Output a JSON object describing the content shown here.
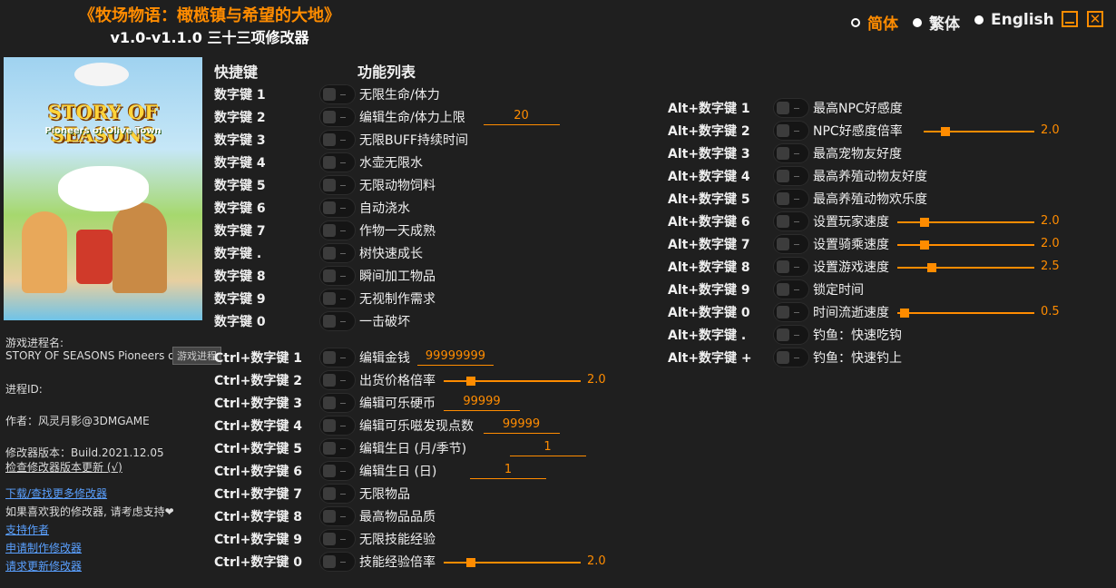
{
  "header": {
    "title": "《牧场物语：橄榄镇与希望的大地》",
    "subtitle": "v1.0-v1.1.0 三十三项修改器",
    "languages": [
      "简体",
      "繁体",
      "English"
    ],
    "selected_language": "简体",
    "accent_color": "#ff8c00"
  },
  "cover": {
    "logo": "STORY OF SEASONS",
    "sublogo": "Pioneers of Olive Town"
  },
  "info": {
    "process_label": "游戏进程名:",
    "process_value": "STORY OF SEASONS Pioneers of Olive",
    "process_tooltip": "游戏进程",
    "pid_label": "进程ID:",
    "author": "作者：风灵月影@3DMGAME",
    "version": "修改器版本：Build.2021.12.05",
    "check_update": "检查修改器版本更新 (√)",
    "download": "下载/查找更多修改器",
    "support_text": "如果喜欢我的修改器, 请考虑支持❤",
    "support_author": "支持作者",
    "request_make": "申请制作修改器",
    "request_update": "请求更新修改器"
  },
  "columns": {
    "hotkey": "快捷键",
    "features": "功能列表"
  },
  "left_features": [
    {
      "key": "数字键 1",
      "name": "无限生命/体力"
    },
    {
      "key": "数字键 2",
      "name": "编辑生命/体力上限",
      "value": "20"
    },
    {
      "key": "数字键 3",
      "name": "无限BUFF持续时间"
    },
    {
      "key": "数字键 4",
      "name": "水壶无限水"
    },
    {
      "key": "数字键 5",
      "name": "无限动物饲料"
    },
    {
      "key": "数字键 6",
      "name": "自动浇水"
    },
    {
      "key": "数字键 7",
      "name": "作物一天成熟"
    },
    {
      "key": "数字键 .",
      "name": "树快速成长"
    },
    {
      "key": "数字键 8",
      "name": "瞬间加工物品"
    },
    {
      "key": "数字键 9",
      "name": "无视制作需求"
    },
    {
      "key": "数字键 0",
      "name": "一击破坏"
    },
    {
      "key": "Ctrl+数字键 1",
      "name": "编辑金钱",
      "value": "99999999"
    },
    {
      "key": "Ctrl+数字键 2",
      "name": "出货价格倍率",
      "slider": 2.0
    },
    {
      "key": "Ctrl+数字键 3",
      "name": "编辑可乐硬币",
      "value": "99999"
    },
    {
      "key": "Ctrl+数字键 4",
      "name": "编辑可乐嗞发现点数",
      "value": "99999"
    },
    {
      "key": "Ctrl+数字键 5",
      "name": "编辑生日 (月/季节)",
      "value": "1"
    },
    {
      "key": "Ctrl+数字键 6",
      "name": "编辑生日 (日)",
      "value": "1"
    },
    {
      "key": "Ctrl+数字键 7",
      "name": "无限物品"
    },
    {
      "key": "Ctrl+数字键 8",
      "name": "最高物品品质"
    },
    {
      "key": "Ctrl+数字键 9",
      "name": "无限技能经验"
    },
    {
      "key": "Ctrl+数字键 0",
      "name": "技能经验倍率",
      "slider": 2.0
    }
  ],
  "right_features": [
    {
      "key": "Alt+数字键 1",
      "name": "最高NPC好感度"
    },
    {
      "key": "Alt+数字键 2",
      "name": "NPC好感度倍率",
      "slider": 2.0
    },
    {
      "key": "Alt+数字键 3",
      "name": "最高宠物友好度"
    },
    {
      "key": "Alt+数字键 4",
      "name": "最高养殖动物友好度"
    },
    {
      "key": "Alt+数字键 5",
      "name": "最高养殖动物欢乐度"
    },
    {
      "key": "Alt+数字键 6",
      "name": "设置玩家速度",
      "slider": 2.0
    },
    {
      "key": "Alt+数字键 7",
      "name": "设置骑乘速度",
      "slider": 2.0
    },
    {
      "key": "Alt+数字键 8",
      "name": "设置游戏速度",
      "slider": 2.5
    },
    {
      "key": "Alt+数字键 9",
      "name": "锁定时间"
    },
    {
      "key": "Alt+数字键 0",
      "name": "时间流逝速度",
      "slider": 0.5
    },
    {
      "key": "Alt+数字键 .",
      "name": "钓鱼：快速吃钩"
    },
    {
      "key": "Alt+数字键 +",
      "name": "钓鱼：快速钓上"
    }
  ]
}
